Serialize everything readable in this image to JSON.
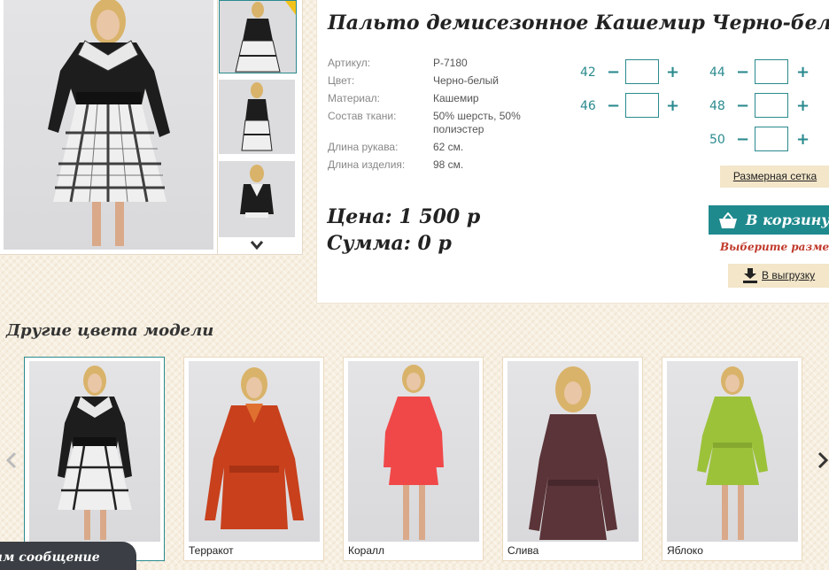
{
  "product": {
    "title": "Пальто демисезонное Кашемир Черно-белый",
    "specs": [
      {
        "label": "Артикул:",
        "value": "P-7180"
      },
      {
        "label": "Цвет:",
        "value": "Черно-белый"
      },
      {
        "label": "Материал:",
        "value": "Кашемир"
      },
      {
        "label": "Состав ткани:",
        "value": "50% шерсть, 50% полиэстер"
      },
      {
        "label": "Длина рукава:",
        "value": "62 см."
      },
      {
        "label": "Длина изделия:",
        "value": "98 см."
      }
    ]
  },
  "sizes": [
    {
      "label": "42",
      "qty": ""
    },
    {
      "label": "44",
      "qty": ""
    },
    {
      "label": "46",
      "qty": ""
    },
    {
      "label": "48",
      "qty": ""
    },
    {
      "label": "50",
      "qty": ""
    }
  ],
  "size_controls": {
    "minus": "−",
    "plus": "+"
  },
  "size_chart_label": "Размерная сетка",
  "price_line": "Цена: 1 500 р",
  "sum_line": "Сумма: 0 р",
  "cart_button": "В корзину",
  "pick_size_warning": "Выберите размер!",
  "export_button": "В выгрузку",
  "other_colors": {
    "title": "Другие цвета модели",
    "items": [
      {
        "label": "",
        "color": "#222222"
      },
      {
        "label": "Терракот",
        "color": "#c8401c"
      },
      {
        "label": "Коралл",
        "color": "#f04848"
      },
      {
        "label": "Слива",
        "color": "#5a3438"
      },
      {
        "label": "Яблоко",
        "color": "#9cc23a"
      }
    ]
  },
  "chat_tab": "ам сообщение",
  "colors": {
    "accent": "#1f8a8e",
    "warning": "#c0392b",
    "beige_button": "#f3e6c9"
  },
  "icons": [
    "chevron-down-icon",
    "cart-icon",
    "download-icon",
    "chevron-left-icon",
    "chevron-right-icon"
  ]
}
